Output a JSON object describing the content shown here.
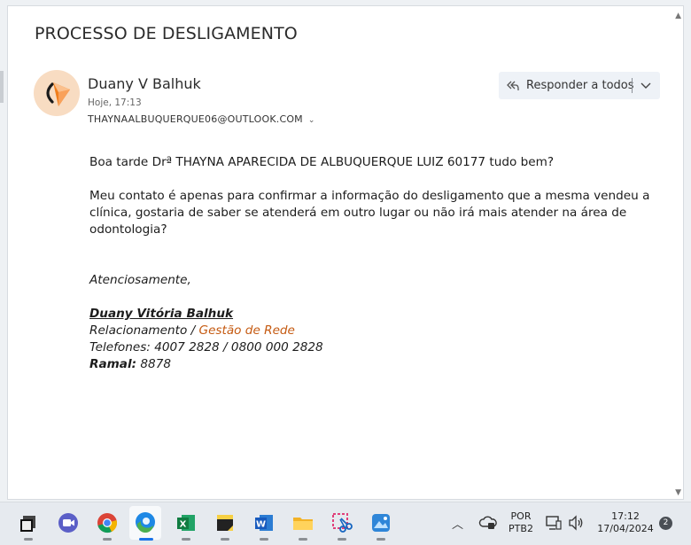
{
  "email": {
    "subject": "PROCESSO DE DESLIGAMENTO",
    "sender_name": "Duany V Balhuk",
    "date": "Hoje, 17:13",
    "recipient": "THAYNAALBUQUERQUE06@OUTLOOK.COM",
    "reply_all_label": "Responder a todos",
    "body": {
      "greeting": "Boa tarde Drª THAYNA APARECIDA DE ALBUQUERQUE LUIZ 60177 tudo bem?",
      "paragraph": "Meu contato é apenas para confirmar a informação do desligamento que a mesma vendeu a clínica, gostaria de saber se atenderá em outro lugar ou não irá mais atender na área de odontologia?",
      "closing": "Atenciosamente,",
      "sig_name": "Duany Vitória Balhuk ",
      "sig_role_prefix": "Relacionamento / ",
      "sig_role_dept": "Gestão de Rede",
      "sig_phones": "Telefones: 4007 2828 / 0800 000 2828",
      "sig_ramal_label": "Ramal:",
      "sig_ramal_value": " 8878"
    }
  },
  "taskbar": {
    "lang_top": "POR",
    "lang_bottom": "PTB2",
    "time": "17:12",
    "date": "17/04/2024",
    "notification_count": "2",
    "apps": [
      "file-explorer-window-icon",
      "video-chat-icon",
      "chrome-icon",
      "edge-icon",
      "excel-icon",
      "sticky-notes-icon",
      "word-icon",
      "folder-icon",
      "snipping-tool-icon",
      "photos-icon"
    ]
  },
  "colors": {
    "accent_orange": "#c55a11",
    "avatar_bg": "#f8dcc2",
    "logo_orange": "#f07e1c"
  }
}
